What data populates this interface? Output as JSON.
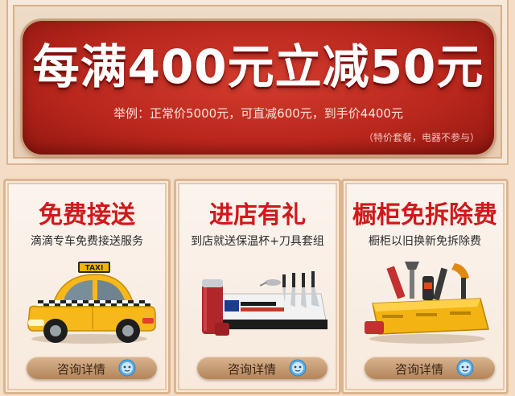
{
  "banner": {
    "title": "每满400元立减50元",
    "example": "举例：正常价5000元，可直减600元，到手价4400元",
    "note": "（特价套餐，电器不参与）"
  },
  "cards": [
    {
      "title": "免费接送",
      "subtitle": "滴滴专车免费接送服务",
      "taxi_sign": "TAXI",
      "button_label": "咨询详情"
    },
    {
      "title": "进店有礼",
      "subtitle": "到店就送保温杯+刀具套组",
      "button_label": "咨询详情"
    },
    {
      "title": "橱柜免拆除费",
      "subtitle": "橱柜以旧换新免拆除费",
      "button_label": "咨询详情"
    }
  ],
  "colors": {
    "banner_red": "#c02a1f",
    "title_red": "#d0191b",
    "frame_tan": "#dcb58f",
    "button_gold": "#c49a6f"
  },
  "icons": {
    "button_icon": "chat-bubble-face-icon"
  }
}
